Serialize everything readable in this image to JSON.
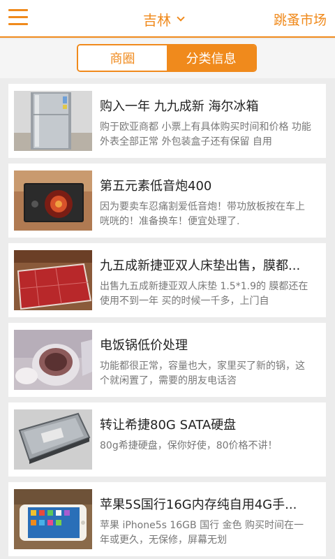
{
  "header": {
    "city": "吉林",
    "market_link": "跳蚤市场",
    "accent_color": "#f08a1c"
  },
  "tabs": [
    {
      "label": "商圈",
      "active": false
    },
    {
      "label": "分类信息",
      "active": true
    }
  ],
  "listings": [
    {
      "title": "购入一年 九九成新 海尔冰箱",
      "desc": "购于欧亚商都 小票上有具体购买时间和价格 功能外表全部正常 外包装盒子还有保留 自用",
      "image": "fridge"
    },
    {
      "title": "第五元素低音炮400",
      "desc": "因为要卖车忍痛割爱低音炮！带功放板按在车上咣咣的！准备换车！便宜处理了.",
      "image": "subwoofer"
    },
    {
      "title": "九五成新捷亚双人床垫出售，膜都...",
      "desc": "出售九五成新捷亚双人床垫 1.5*1.9的 膜都还在 使用不到一年 买的时候一千多，上门自",
      "image": "mattress"
    },
    {
      "title": "电饭锅低价处理",
      "desc": "功能都很正常，容量也大，家里买了新的锅，这个就闲置了，需要的朋友电话咨",
      "image": "rice-cooker"
    },
    {
      "title": "转让希捷80G SATA硬盘",
      "desc": "80g希捷硬盘，保你好使，80价格不讲！",
      "image": "hard-drive"
    },
    {
      "title": "苹果5S国行16G内存纯自用4G手...",
      "desc": "苹果 iPhone5s 16GB 国行 金色 购买时间在一年或更久，无保修，屏幕无划",
      "image": "iphone"
    }
  ]
}
